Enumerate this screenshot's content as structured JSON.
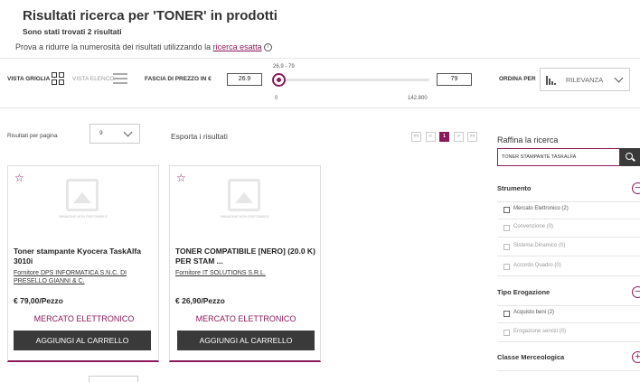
{
  "header": {
    "title": "Risultati ricerca per 'TONER' in prodotti",
    "subtitle": "Sono stati trovati 2 risultati",
    "hint_prefix": "Prova a ridurre la numerosità dei risultati utilizzando la ",
    "hint_link": "ricerca esatta",
    "hint_icon": "i"
  },
  "toolbar": {
    "view_grid": "VISTA GRIGLIA",
    "view_list": "VISTA ELENCO",
    "price_label": "FASCIA DI PREZZO IN €",
    "price_min": "26.9",
    "price_max": "79",
    "range_display": "26,9 - 79",
    "slider_min": "0",
    "slider_max": "142.800",
    "sort_label": "ORDINA PER",
    "sort_value": "RILEVANZA"
  },
  "results_bar": {
    "per_page_label": "Risultati per pagina",
    "per_page_value": "9",
    "export_label": "Esporta i risultati",
    "pager": [
      "<<",
      "<",
      "1",
      ">",
      ">>"
    ]
  },
  "products": [
    {
      "title": "Toner stampante Kyocera TaskAlfa 3010i",
      "supplier": "Fornitore DPS INFORMATICA S.N.C. DI PRESELLO GIANNI & C.",
      "price": "€ 79,00/Pezzo",
      "channel": "MERCATO ELETTRONICO",
      "button": "AGGIUNGI AL CARRELLO",
      "noimage": "IMMAGINE NON DISPONIBILE"
    },
    {
      "title": "TONER COMPATIBILE [NERO] (20.0 K) PER STAM ...",
      "supplier": "Fornitore IT SOLUTIONS S.R.L.",
      "price": "€ 26,90/Pezzo",
      "channel": "MERCATO ELETTRONICO",
      "button": "AGGIUNGI AL CARRELLO",
      "noimage": "IMMAGINE NON DISPONIBILE"
    }
  ],
  "sidebar": {
    "title": "Raffina la ricerca",
    "search_value": "TONER STAMPANTE TASKALFA",
    "sections": [
      {
        "title": "Strumento",
        "toggle": "−",
        "items": [
          {
            "label": "Mercato Elettronico (2)"
          },
          {
            "label": "Convenzione (0)"
          },
          {
            "label": "Sistema Dinamico (0)"
          },
          {
            "label": "Accordo Quadro (0)"
          }
        ]
      },
      {
        "title": "Tipo Erogazione",
        "toggle": "−",
        "items": [
          {
            "label": "Acquisto beni (2)"
          },
          {
            "label": "Erogazione servizi (0)"
          }
        ]
      },
      {
        "title": "Classe Merceologica",
        "toggle": "+",
        "items": []
      }
    ]
  },
  "colors": {
    "accent": "#8b1a5a",
    "button_dark": "#3a3a3a"
  }
}
